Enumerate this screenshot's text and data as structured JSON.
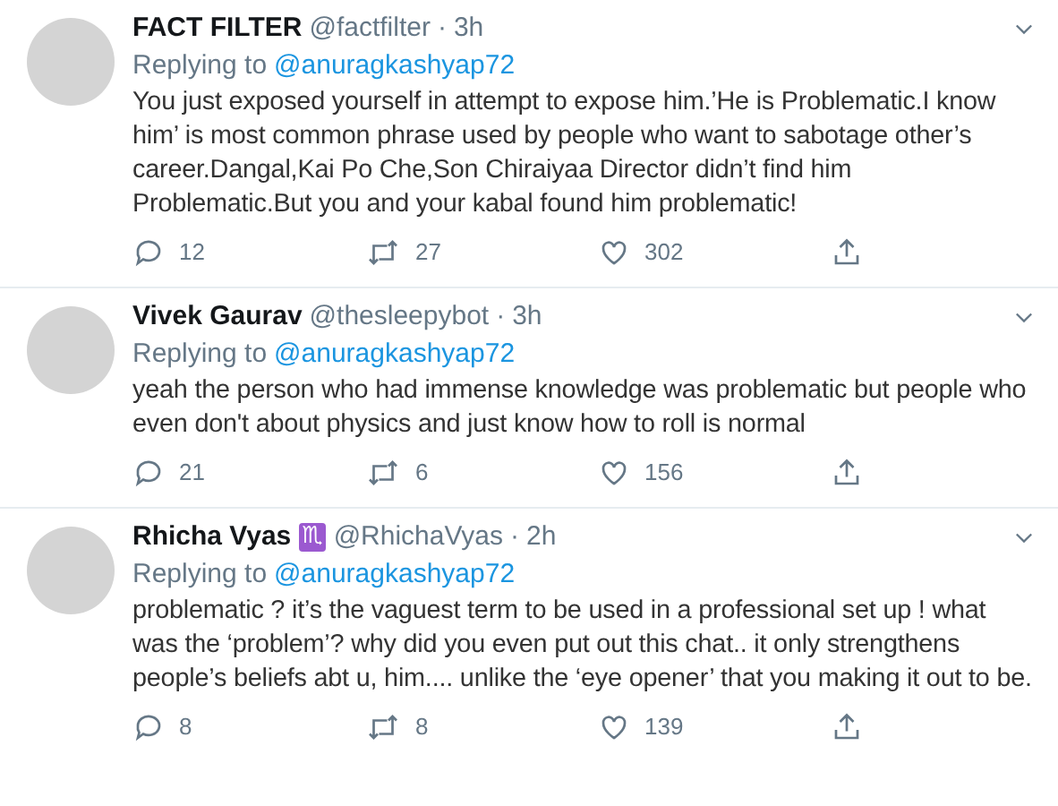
{
  "tweets": [
    {
      "name": "FACT FILTER",
      "handle": "@factfilter",
      "separator": "·",
      "time": "3h",
      "replying_label": "Replying to",
      "replying_to": "@anuragkashyap72",
      "text": "You just exposed yourself in attempt to expose him.’He is Problematic.I know him’ is most common phrase used by people who want to sabotage other’s career.Dangal,Kai Po Che,Son Chiraiyaa Director didn’t find him Problematic.But you and your kabal found him problematic!",
      "replies": "12",
      "retweets": "27",
      "likes": "302"
    },
    {
      "name": "Vivek Gaurav",
      "handle": "@thesleepybot",
      "separator": "·",
      "time": "3h",
      "replying_label": "Replying to",
      "replying_to": "@anuragkashyap72",
      "text": "yeah the person who had immense knowledge was problematic but people who even don't about physics and just know how to roll is normal",
      "replies": "21",
      "retweets": "6",
      "likes": "156"
    },
    {
      "name": "Rhicha Vyas",
      "badge": "♏",
      "handle": "@RhichaVyas",
      "separator": "·",
      "time": "2h",
      "replying_label": "Replying to",
      "replying_to": "@anuragkashyap72",
      "text": "problematic ? it’s the vaguest term to be used in a professional set up ! what was the ‘problem’? why did you even put out this chat.. it only strengthens people’s beliefs abt u, him.... unlike the ‘eye opener’ that you making it out to be.",
      "replies": "8",
      "retweets": "8",
      "likes": "139"
    }
  ]
}
